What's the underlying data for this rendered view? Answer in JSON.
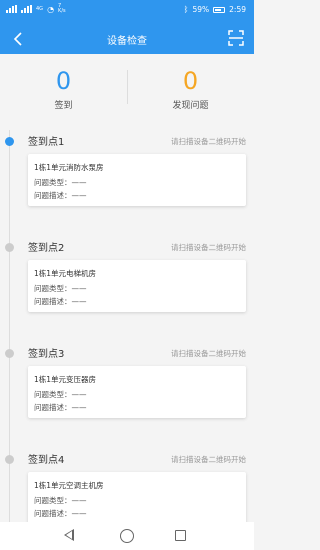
{
  "status_bar": {
    "network": "4G",
    "speed": "7 K/s",
    "battery_percent": "59%",
    "time": "2:59"
  },
  "header": {
    "title": "设备检查",
    "back_icon": "back-chevron-icon",
    "scan_icon": "scan-icon"
  },
  "summary": {
    "signed_count": "0",
    "signed_label": "签到",
    "issue_count": "0",
    "issue_label": "发现问题",
    "signed_color": "#2f96ee",
    "issue_color": "#f5a623"
  },
  "points": [
    {
      "title": "签到点1",
      "hint": "请扫描设备二维码开始",
      "device": "1栋1单元消防水泵房",
      "type_label": "问题类型：",
      "type_value": "——",
      "desc_label": "问题描述：",
      "desc_value": "——",
      "active": true
    },
    {
      "title": "签到点2",
      "hint": "请扫描设备二维码开始",
      "device": "1栋1单元电梯机房",
      "type_label": "问题类型：",
      "type_value": "——",
      "desc_label": "问题描述：",
      "desc_value": "——",
      "active": false
    },
    {
      "title": "签到点3",
      "hint": "请扫描设备二维码开始",
      "device": "1栋1单元变压器房",
      "type_label": "问题类型：",
      "type_value": "——",
      "desc_label": "问题描述：",
      "desc_value": "——",
      "active": false
    },
    {
      "title": "签到点4",
      "hint": "请扫描设备二维码开始",
      "device": "1栋1单元空调主机房",
      "type_label": "问题类型：",
      "type_value": "——",
      "desc_label": "问题描述：",
      "desc_value": "——",
      "active": false
    }
  ],
  "nav": {
    "back_icon": "triangle-back-icon",
    "home_icon": "circle-home-icon",
    "recent_icon": "square-recents-icon"
  }
}
